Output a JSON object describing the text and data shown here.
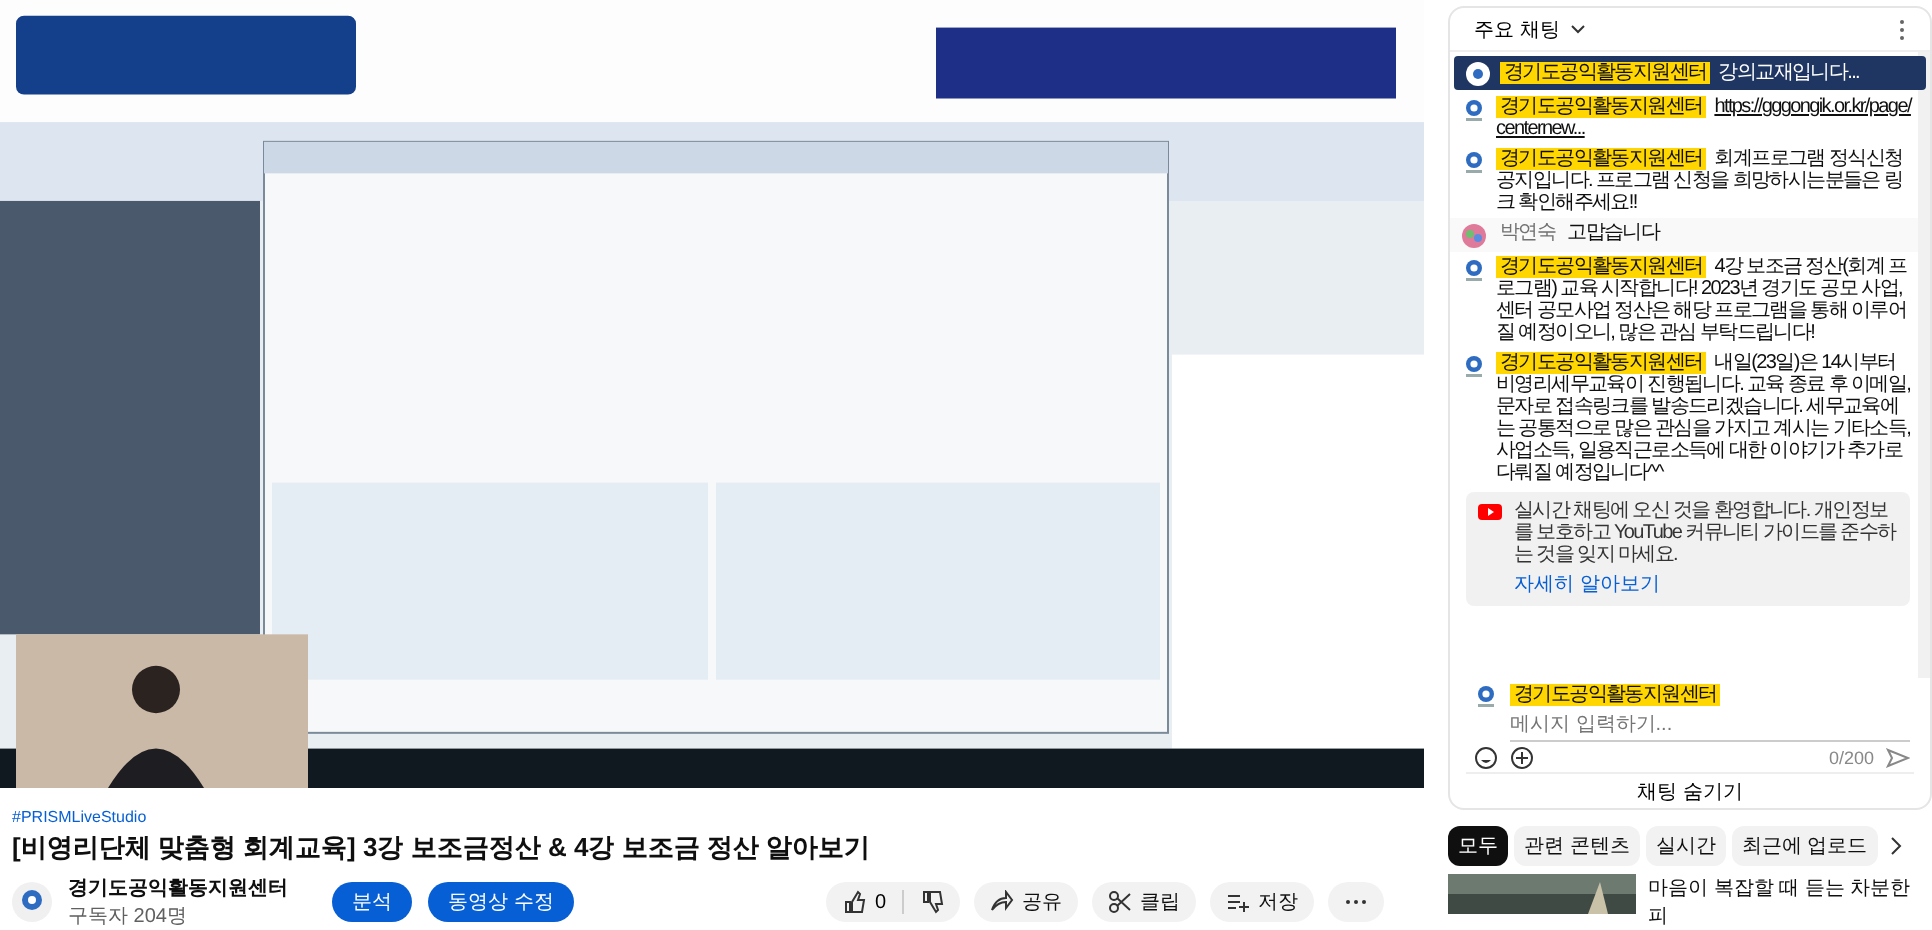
{
  "hashtag": "#PRISMLiveStudio",
  "title": "[비영리단체 맞춤형 회계교육] 3강 보조금정산 & 4강 보조금 정산 알아보기",
  "channel": {
    "name": "경기도공익활동지원센터",
    "subscribers": "구독자 204명"
  },
  "owner_buttons": [
    "분석",
    "동영상 수정"
  ],
  "actions": [
    {
      "kind": "like",
      "label": "0"
    },
    {
      "kind": "share",
      "label": "공유"
    },
    {
      "kind": "clip",
      "label": "클립"
    },
    {
      "kind": "save",
      "label": "저장"
    },
    {
      "kind": "more"
    }
  ],
  "chat": {
    "title": "주요 채팅",
    "pinned": {
      "author": "경기도공익활동지원센터",
      "text": "강의교재입니다..."
    },
    "messages": [
      {
        "author": "경기도공익활동지원센터",
        "owner": true,
        "text": "https://gggongik.or.kr/page/centernew...",
        "link": true
      },
      {
        "author": "경기도공익활동지원센터",
        "owner": true,
        "text": "회계프로그램 정식신청공지입니다. 프로그램 신청을 희망하시는분들은 링크 확인해주세요!!",
        "link": false
      },
      {
        "author": "박연숙",
        "owner": false,
        "text": "고맙습니다",
        "link": false
      },
      {
        "author": "경기도공익활동지원센터",
        "owner": true,
        "text": "4강 보조금 정산(회계 프로그램) 교육 시작합니다! 2023년 경기도 공모 사업, 센터 공모사업 정산은 해당 프로그램을 통해 이루어질 예정이오니, 많은 관심 부탁드립니다!",
        "link": false
      },
      {
        "author": "경기도공익활동지원센터",
        "owner": true,
        "text": "내일(23일)은 14시부터 비영리세무교육이 진행됩니다. 교육 종료 후 이메일,문자로 접속링크를 발송드리겠습니다. 세무교육에는 공통적으로 많은 관심을 가지고 계시는 기타소득, 사업소득, 일용직근로소득에 대한 이야기가 추가로 다뤄질 예정입니다^^",
        "link": false
      }
    ],
    "notice": {
      "text": "실시간 채팅에 오신 것을 환영합니다. 개인정보를 보호하고 YouTube 커뮤니티 가이드를 준수하는 것을 잊지 마세요.",
      "link": "자세히 알아보기"
    },
    "input": {
      "author": "경기도공익활동지원센터",
      "placeholder": "메시지 입력하기...",
      "counter": "0/200"
    },
    "hide_button": "채팅 숨기기"
  },
  "chips": [
    {
      "label": "모두",
      "selected": true
    },
    {
      "label": "관련 콘텐츠",
      "selected": false
    },
    {
      "label": "실시간",
      "selected": false
    },
    {
      "label": "최근에 업로드",
      "selected": false
    }
  ],
  "recommended": [
    {
      "title": "마음이 복잡할 때 듣는 차분한 피"
    }
  ]
}
